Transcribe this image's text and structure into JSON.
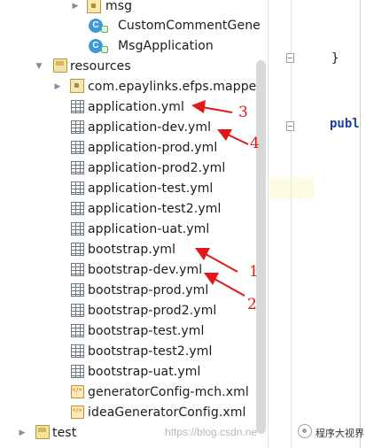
{
  "tree": {
    "rows": [
      {
        "label": "msg",
        "kind": "package"
      },
      {
        "label": "CustomCommentGene",
        "kind": "class"
      },
      {
        "label": "MsgApplication",
        "kind": "class"
      },
      {
        "label": "resources",
        "kind": "folder"
      },
      {
        "label": "com.epaylinks.efps.mapper",
        "kind": "package"
      },
      {
        "label": "application.yml",
        "kind": "yml"
      },
      {
        "label": "application-dev.yml",
        "kind": "yml"
      },
      {
        "label": "application-prod.yml",
        "kind": "yml"
      },
      {
        "label": "application-prod2.yml",
        "kind": "yml"
      },
      {
        "label": "application-test.yml",
        "kind": "yml"
      },
      {
        "label": "application-test2.yml",
        "kind": "yml"
      },
      {
        "label": "application-uat.yml",
        "kind": "yml"
      },
      {
        "label": "bootstrap.yml",
        "kind": "yml"
      },
      {
        "label": "bootstrap-dev.yml",
        "kind": "yml"
      },
      {
        "label": "bootstrap-prod.yml",
        "kind": "yml"
      },
      {
        "label": "bootstrap-prod2.yml",
        "kind": "yml"
      },
      {
        "label": "bootstrap-test.yml",
        "kind": "yml"
      },
      {
        "label": "bootstrap-test2.yml",
        "kind": "yml"
      },
      {
        "label": "bootstrap-uat.yml",
        "kind": "yml"
      },
      {
        "label": "generatorConfig-mch.xml",
        "kind": "xml"
      },
      {
        "label": "ideaGeneratorConfig.xml",
        "kind": "xml"
      },
      {
        "label": "test",
        "kind": "folder"
      }
    ]
  },
  "editor": {
    "line1": "}",
    "line2": "publ"
  },
  "annotations": {
    "n1": "1",
    "n2": "2",
    "n3": "3",
    "n4": "4",
    "color": "#e01818"
  },
  "watermark": {
    "url": "https://blog.csdn.ne",
    "brand": "程序大视界"
  },
  "icons": {
    "expand": "chevron-right-icon",
    "collapse": "chevron-down-icon"
  }
}
